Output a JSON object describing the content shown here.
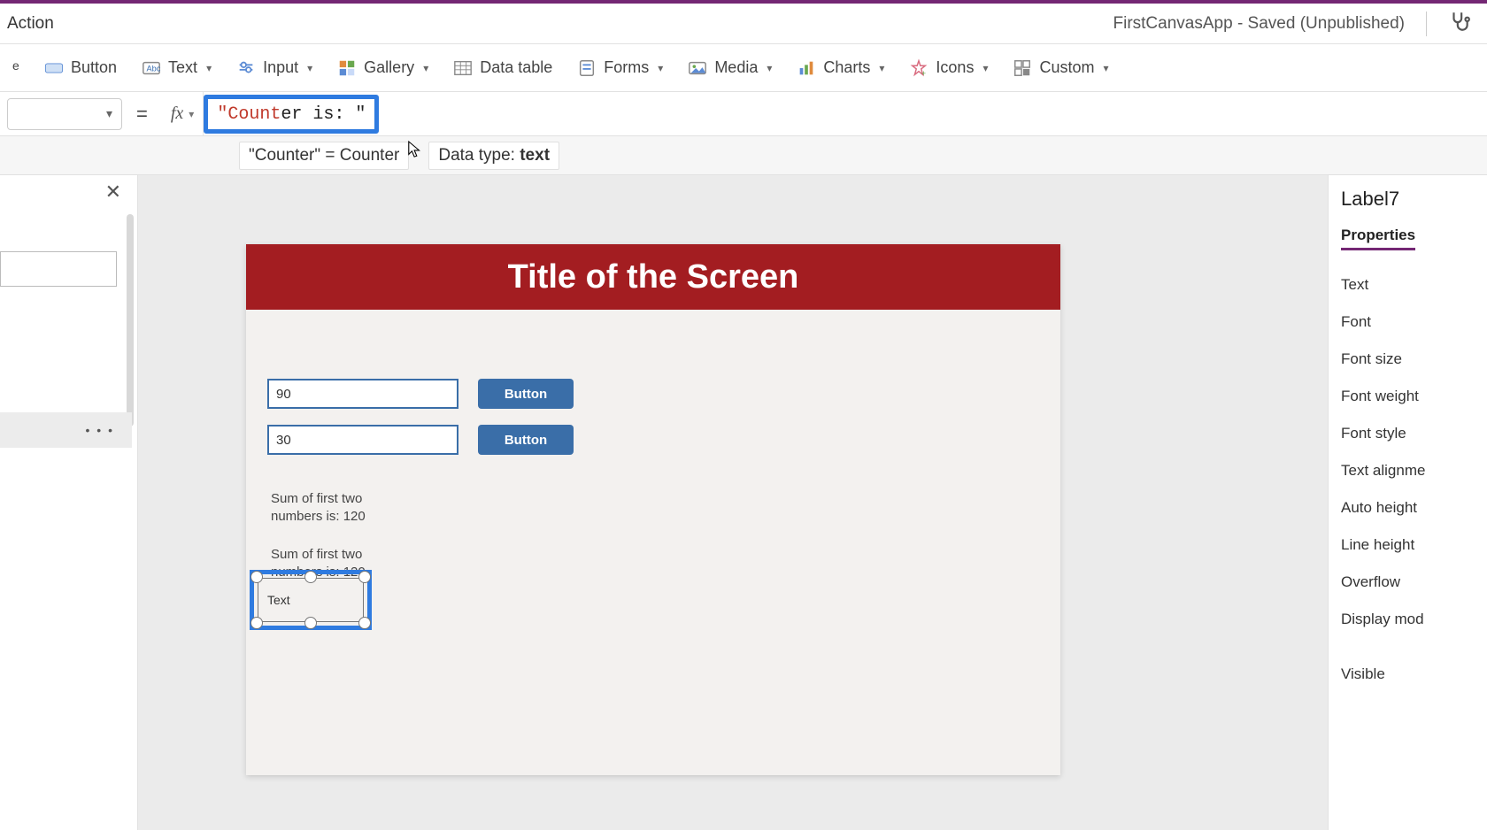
{
  "titlebar": {
    "action_label": "Action",
    "app_status": "FirstCanvasApp - Saved (Unpublished)"
  },
  "ribbon": {
    "label_cut": "el",
    "button": "Button",
    "text": "Text",
    "input": "Input",
    "gallery": "Gallery",
    "datatable": "Data table",
    "forms": "Forms",
    "media": "Media",
    "charts": "Charts",
    "icons": "Icons",
    "custom": "Custom"
  },
  "formula": {
    "fx": "fx",
    "equals": "=",
    "value_display": "\"Counter is: \"",
    "value_red_part": "\"Count",
    "value_black_part": "er is: \"",
    "hint_lhs": "\"Counter\"  =  Counter",
    "datatype_prefix": "Data type: ",
    "datatype_value": "text"
  },
  "left": {
    "tree_more": "• • •"
  },
  "canvas": {
    "screen_title": "Title of the Screen",
    "input1_value": "90",
    "input2_value": "30",
    "button1_label": "Button",
    "button2_label": "Button",
    "sum_text_1": "Sum of first two numbers is: 120",
    "sum_text_2": "Sum of first two numbers is: 120",
    "selected_text": "Text"
  },
  "props": {
    "element_name": "Label7",
    "tab": "Properties",
    "rows": {
      "text": "Text",
      "font": "Font",
      "font_size": "Font size",
      "font_weight": "Font weight",
      "font_style": "Font style",
      "text_align": "Text alignme",
      "auto_height": "Auto height",
      "line_height": "Line height",
      "overflow": "Overflow",
      "display_mode": "Display mod",
      "visible": "Visible"
    }
  }
}
